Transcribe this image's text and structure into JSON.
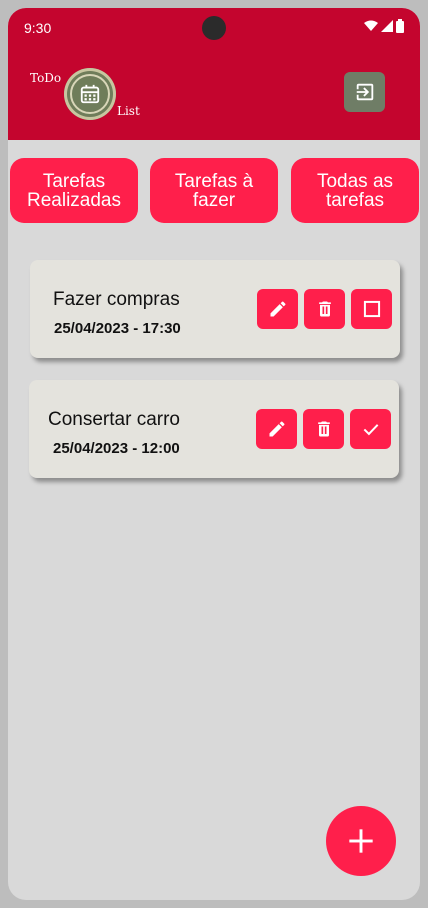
{
  "status_bar": {
    "time": "9:30"
  },
  "app_bar": {
    "logo_text_top": "ToDo",
    "logo_text_bottom": "List",
    "logo_icon": "calendar-icon",
    "logout_icon": "logout-icon"
  },
  "filters": [
    {
      "label": "Tarefas\nRealizadas"
    },
    {
      "label": "Tarefas à\nfazer"
    },
    {
      "label": "Todas as\ntarefas"
    }
  ],
  "tasks": [
    {
      "title": "Fazer compras",
      "datetime": "25/04/2023 - 17:30",
      "status_icon": "checkbox-empty-icon"
    },
    {
      "title": "Consertar carro",
      "datetime": "25/04/2023 - 12:00",
      "status_icon": "check-icon"
    }
  ],
  "fab": {
    "icon": "plus-icon"
  },
  "colors": {
    "primary": "#c4052e",
    "accent": "#ff1f4b",
    "card": "#e4e3dd",
    "background": "#d9d9d9",
    "logo": "#6f7d5a"
  }
}
